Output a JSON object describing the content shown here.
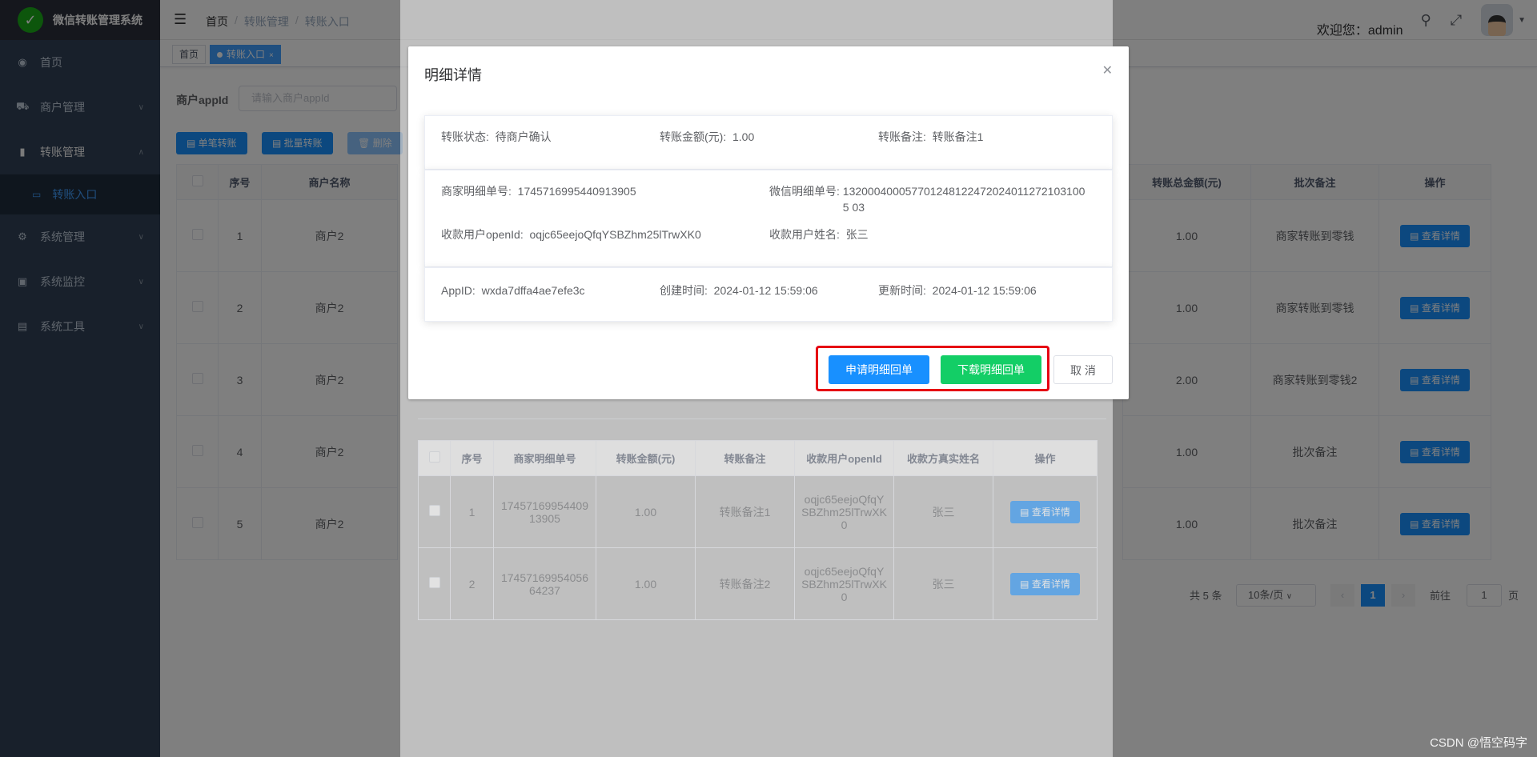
{
  "app": {
    "title": "微信转账管理系统",
    "logo_icon": "wechat-icon"
  },
  "sidebar": {
    "items": [
      {
        "label": "首页",
        "icon": "dashboard-icon"
      },
      {
        "label": "商户管理",
        "icon": "merchant-icon"
      },
      {
        "label": "转账管理",
        "icon": "transfer-icon"
      },
      {
        "label": "转账入口",
        "icon": "entry-icon"
      },
      {
        "label": "系统管理",
        "icon": "gear-icon"
      },
      {
        "label": "系统监控",
        "icon": "monitor-icon"
      },
      {
        "label": "系统工具",
        "icon": "toolbox-icon"
      }
    ]
  },
  "navbar": {
    "breadcrumb": [
      "首页",
      "转账管理",
      "转账入口"
    ],
    "welcome": "欢迎您：admin"
  },
  "tags": [
    {
      "label": "首页"
    },
    {
      "label": "转账入口"
    }
  ],
  "query": {
    "label": "商户appId",
    "placeholder": "请输入商户appId"
  },
  "toolbar": {
    "single": "单笔转账",
    "batch": "批量转账",
    "delete": "删除"
  },
  "main_table": {
    "headers": [
      "序号",
      "商户名称"
    ],
    "rows": [
      {
        "no": "1",
        "merchant": "商户2"
      },
      {
        "no": "2",
        "merchant": "商户2"
      },
      {
        "no": "3",
        "merchant": "商户2"
      },
      {
        "no": "4",
        "merchant": "商户2"
      },
      {
        "no": "5",
        "merchant": "商户2"
      }
    ]
  },
  "right_table": {
    "headers": [
      "转账总金额(元)",
      "批次备注",
      "操作"
    ],
    "rows": [
      {
        "amount": "1.00",
        "remark": "商家转账到零钱"
      },
      {
        "amount": "1.00",
        "remark": "商家转账到零钱"
      },
      {
        "amount": "2.00",
        "remark": "商家转账到零钱2"
      },
      {
        "amount": "1.00",
        "remark": "批次备注"
      },
      {
        "amount": "1.00",
        "remark": "批次备注"
      }
    ],
    "action": "查看详情"
  },
  "pagination": {
    "total": "共 5 条",
    "page_size": "10条/页",
    "current": "1",
    "goto_label": "前往",
    "goto_value": "1",
    "page_unit": "页"
  },
  "detail_table": {
    "headers": [
      "序号",
      "商家明细单号",
      "转账金额(元)",
      "转账备注",
      "收款用户openId",
      "收款方真实姓名",
      "操作"
    ],
    "rows": [
      {
        "no": "1",
        "detail_no": "1745716995440913905",
        "amount": "1.00",
        "remark": "转账备注1",
        "openid": "oqjc65eejoQfqYSBZhm25lTrwXK0",
        "name": "张三"
      },
      {
        "no": "2",
        "detail_no": "1745716995405664237",
        "amount": "1.00",
        "remark": "转账备注2",
        "openid": "oqjc65eejoQfqYSBZhm25lTrwXK0",
        "name": "张三"
      }
    ],
    "action": "查看详情"
  },
  "dialog": {
    "title": "明细详情",
    "status_label": "转账状态:",
    "status_value": "待商户确认",
    "amount_label": "转账金额(元):",
    "amount_value": "1.00",
    "remark_label": "转账备注:",
    "remark_value": "转账备注1",
    "merchant_detail_label": "商家明细单号:",
    "merchant_detail_value": "1745716995440913905",
    "wechat_detail_label": "微信明细单号:",
    "wechat_detail_value": "1320004000577012481224720240112721031005 03",
    "openid_label": "收款用户openId:",
    "openid_value": "oqjc65eejoQfqYSBZhm25lTrwXK0",
    "username_label": "收款用户姓名:",
    "username_value": "张三",
    "appid_label": "AppID:",
    "appid_value": "wxda7dffa4ae7efe3c",
    "created_label": "创建时间:",
    "created_value": "2024-01-12 15:59:06",
    "updated_label": "更新时间:",
    "updated_value": "2024-01-12 15:59:06",
    "apply_button": "申请明细回单",
    "download_button": "下载明细回单",
    "cancel_button": "取 消"
  },
  "watermark": "CSDN @悟空码字",
  "colors": {
    "sidebar_bg": "#304156",
    "primary": "#1890ff",
    "success": "#13ce66",
    "highlight": "#e60012"
  }
}
